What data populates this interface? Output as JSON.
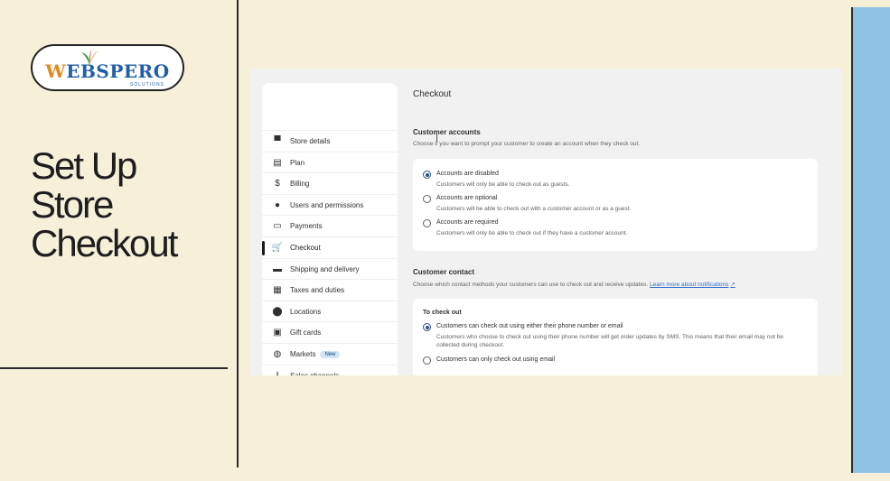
{
  "slide": {
    "logo_text_first": "W",
    "logo_text_rest": "EBSPERO",
    "logo_sub": "SOLUTIONS",
    "title": "Set Up\nStore\nCheckout",
    "accent_color": "#8ec3e6",
    "background_color": "#f6f0d9"
  },
  "sidebar": {
    "items": [
      {
        "label": "Store details",
        "icon": "store-icon",
        "glyph": "▀"
      },
      {
        "label": "Plan",
        "icon": "plan-icon",
        "glyph": "▤"
      },
      {
        "label": "Billing",
        "icon": "billing-icon",
        "glyph": "$"
      },
      {
        "label": "Users and permissions",
        "icon": "user-icon",
        "glyph": "●"
      },
      {
        "label": "Payments",
        "icon": "payments-icon",
        "glyph": "▭"
      },
      {
        "label": "Checkout",
        "icon": "cart-icon",
        "glyph": "🛒"
      },
      {
        "label": "Shipping and delivery",
        "icon": "truck-icon",
        "glyph": "▬"
      },
      {
        "label": "Taxes and duties",
        "icon": "tax-icon",
        "glyph": "▦"
      },
      {
        "label": "Locations",
        "icon": "location-icon",
        "glyph": "⬤"
      },
      {
        "label": "Gift cards",
        "icon": "gift-icon",
        "glyph": "▣"
      },
      {
        "label": "Markets",
        "icon": "globe-icon",
        "glyph": "◍",
        "badge": "New"
      },
      {
        "label": "Sales channels",
        "icon": "channels-icon",
        "glyph": "⅄"
      }
    ],
    "active": "Checkout"
  },
  "main": {
    "title": "Checkout",
    "customer_accounts": {
      "heading": "Customer accounts",
      "description": "Choose if you want to prompt your customer to create an account when they check out.",
      "options": [
        {
          "label": "Accounts are disabled",
          "help": "Customers will only be able to check out as guests.",
          "selected": true
        },
        {
          "label": "Accounts are optional",
          "help": "Customers will be able to check out with a customer account or as a guest.",
          "selected": false
        },
        {
          "label": "Accounts are required",
          "help": "Customers will only be able to check out if they have a customer account.",
          "selected": false
        }
      ]
    },
    "customer_contact": {
      "heading": "Customer contact",
      "description": "Choose which contact methods your customers can use to check out and receive updates.",
      "link": "Learn more about notifications",
      "card_heading": "To check out",
      "options": [
        {
          "label": "Customers can check out using either their phone number or email",
          "help": "Customers who choose to check out using their phone number will get order updates by SMS. This means that their email may not be collected during checkout.",
          "selected": true
        },
        {
          "label": "Customers can only check out using email",
          "help": "",
          "selected": false
        }
      ]
    }
  }
}
